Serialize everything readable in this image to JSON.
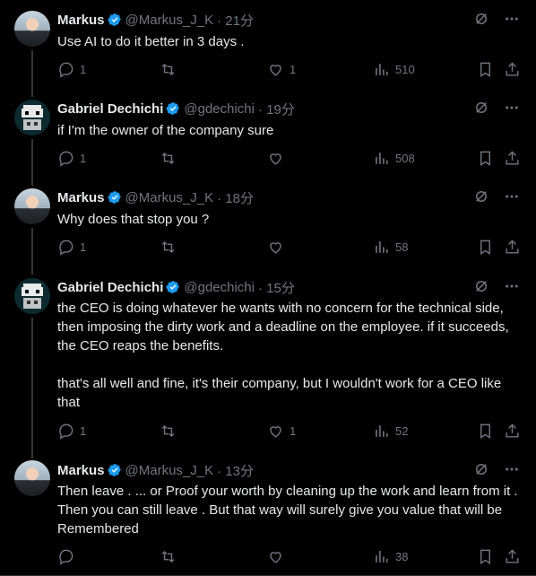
{
  "tweets": [
    {
      "name": "Markus",
      "handle": "@Markus_J_K",
      "time": "· 21分",
      "text": "Use AI to do it better in 3 days .",
      "replies": "1",
      "likes": "1",
      "views": "510"
    },
    {
      "name": "Gabriel Dechichi",
      "handle": "@gdechichi",
      "time": "· 19分",
      "text": "if I'm the owner of the company sure",
      "replies": "1",
      "likes": "",
      "views": "508"
    },
    {
      "name": "Markus",
      "handle": "@Markus_J_K",
      "time": "· 18分",
      "text": "Why does that stop you ?",
      "replies": "1",
      "likes": "",
      "views": "58"
    },
    {
      "name": "Gabriel Dechichi",
      "handle": "@gdechichi",
      "time": "· 15分",
      "text": "the CEO is doing whatever he wants with no concern for the technical side,\nthen imposing the dirty work and a deadline on the employee. if it succeeds,\nthe CEO reaps the benefits.\n\nthat's all well and fine, it's their company, but I wouldn't work for a CEO like\nthat",
      "replies": "1",
      "likes": "1",
      "views": "52"
    },
    {
      "name": "Markus",
      "handle": "@Markus_J_K",
      "time": "· 13分",
      "text": "Then leave . ... or Proof your worth by cleaning up the work and learn from it .\nThen you can still leave . But that way will surely give you value that will be\nRemembered",
      "replies": "",
      "likes": "",
      "views": "38"
    }
  ],
  "colors": {
    "accent": "#1d9bf0",
    "muted": "#71767b",
    "text": "#e7e9ea",
    "background": "#000000"
  }
}
